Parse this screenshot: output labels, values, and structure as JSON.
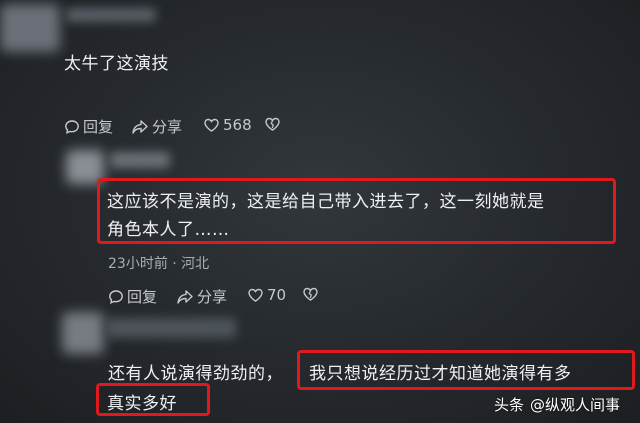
{
  "comments": [
    {
      "text": "太牛了这演技",
      "actions": {
        "reply": "回复",
        "share": "分享",
        "likes": "568"
      }
    },
    {
      "text_line1": "这应该不是演的，这是给自己带入进去了，这一刻她就是",
      "text_line2": "角色本人了……",
      "meta": "23小时前 · 河北",
      "actions": {
        "reply": "回复",
        "share": "分享",
        "likes": "70"
      }
    },
    {
      "text_part1": "还有人说演得劲劲的，",
      "text_part2": "我只想说经历过才知道她演得有多",
      "text_part3": "真实多好"
    }
  ],
  "watermark": {
    "brand": "头条",
    "account": "@纵观人间事"
  },
  "colors": {
    "highlight": "#e0191d",
    "background": "#2b2f33"
  }
}
